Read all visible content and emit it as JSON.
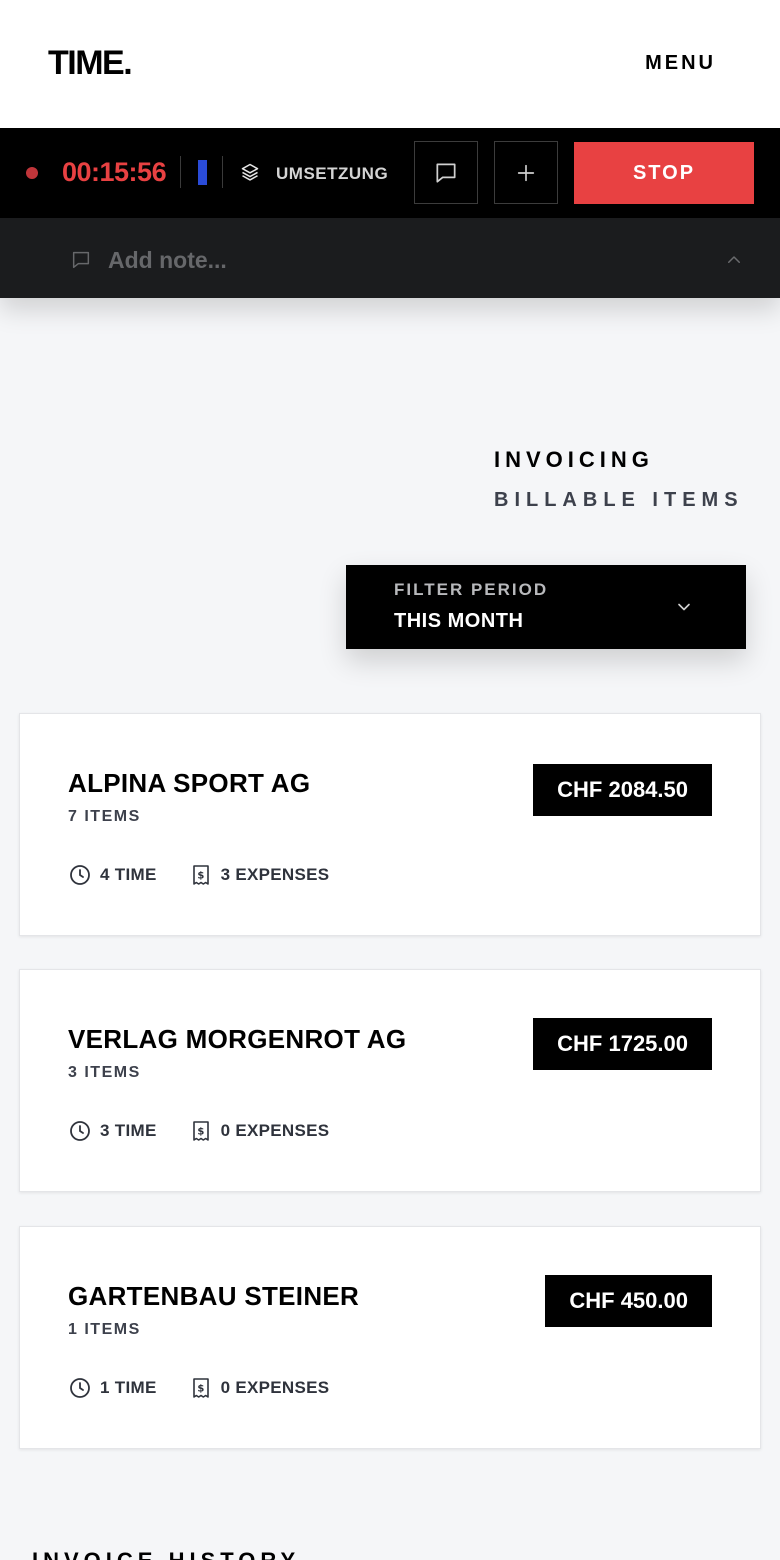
{
  "header": {
    "logo": "TIME.",
    "menu_label": "MENU"
  },
  "timer": {
    "elapsed": "00:15:56",
    "project": "UMSETZUNG",
    "project_color": "#2a4bd7",
    "record_color": "#c0353a",
    "stop_label": "STOP",
    "stop_color": "#e84142",
    "note_placeholder": "Add note..."
  },
  "page": {
    "title": "INVOICING",
    "subtitle": "BILLABLE ITEMS"
  },
  "filter": {
    "label": "FILTER PERIOD",
    "value": "THIS MONTH"
  },
  "clients": [
    {
      "name": "ALPINA SPORT AG",
      "items": "7 ITEMS",
      "amount": "CHF 2084.50",
      "time": "4 TIME",
      "expenses": "3 EXPENSES"
    },
    {
      "name": "VERLAG MORGENROT AG",
      "items": "3 ITEMS",
      "amount": "CHF 1725.00",
      "time": "3 TIME",
      "expenses": "0 EXPENSES"
    },
    {
      "name": "GARTENBAU STEINER",
      "items": "1 ITEMS",
      "amount": "CHF 450.00",
      "time": "1 TIME",
      "expenses": "0 EXPENSES"
    }
  ],
  "history": {
    "title": "INVOICE HISTORY"
  }
}
